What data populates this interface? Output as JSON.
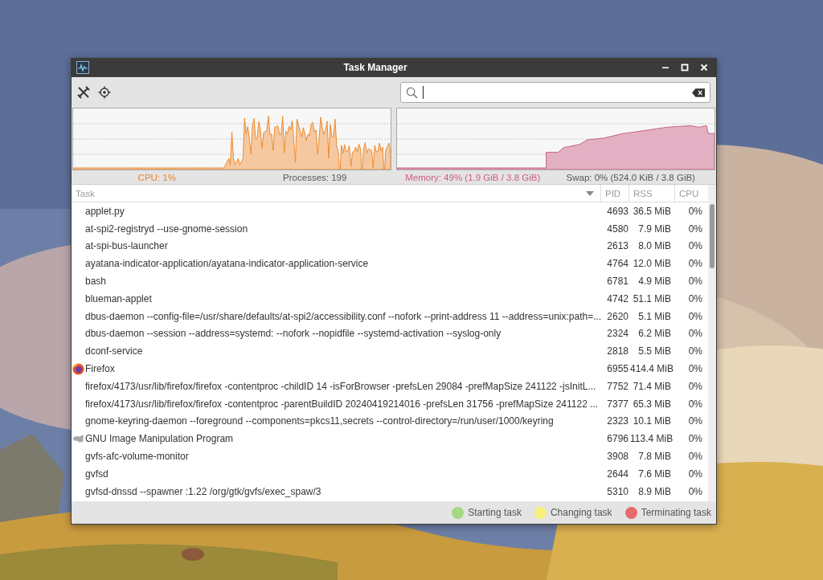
{
  "window": {
    "title": "Task Manager"
  },
  "status": {
    "cpu": "CPU: 1%",
    "processes": "Processes: 199",
    "memory": "Memory: 49% (1.9 GiB / 3.8 GiB)",
    "swap": "Swap: 0% (524.0 KiB / 3.8 GiB)"
  },
  "table": {
    "columns": [
      "Task",
      "PID",
      "RSS",
      "CPU"
    ],
    "rows": [
      {
        "kind": "plain",
        "task": "applet.py",
        "pid": "4693",
        "rss": "36.5 MiB",
        "cpu": "0%"
      },
      {
        "kind": "plain",
        "task": "at-spi2-registryd --use-gnome-session",
        "pid": "4580",
        "rss": "7.9 MiB",
        "cpu": "0%"
      },
      {
        "kind": "plain",
        "task": "at-spi-bus-launcher",
        "pid": "2613",
        "rss": "8.0 MiB",
        "cpu": "0%"
      },
      {
        "kind": "plain",
        "task": "ayatana-indicator-application/ayatana-indicator-application-service",
        "pid": "4764",
        "rss": "12.0 MiB",
        "cpu": "0%"
      },
      {
        "kind": "plain",
        "task": "bash",
        "pid": "6781",
        "rss": "4.9 MiB",
        "cpu": "0%"
      },
      {
        "kind": "plain",
        "task": "blueman-applet",
        "pid": "4742",
        "rss": "51.1 MiB",
        "cpu": "0%"
      },
      {
        "kind": "plain",
        "task": "dbus-daemon --config-file=/usr/share/defaults/at-spi2/accessibility.conf --nofork --print-address 11 --address=unix:path=...",
        "pid": "2620",
        "rss": "5.1 MiB",
        "cpu": "0%"
      },
      {
        "kind": "plain",
        "task": "dbus-daemon --session --address=systemd: --nofork --nopidfile --systemd-activation --syslog-only",
        "pid": "2324",
        "rss": "6.2 MiB",
        "cpu": "0%"
      },
      {
        "kind": "plain",
        "task": "dconf-service",
        "pid": "2818",
        "rss": "5.5 MiB",
        "cpu": "0%"
      },
      {
        "kind": "browser",
        "task": "Firefox",
        "pid": "6955",
        "rss": "414.4 MiB",
        "cpu": "0%"
      },
      {
        "kind": "plain",
        "task": "firefox/4173/usr/lib/firefox/firefox -contentproc -childID 14 -isForBrowser -prefsLen 29084 -prefMapSize 241122 -jsInitL...",
        "pid": "7752",
        "rss": "71.4 MiB",
        "cpu": "0%"
      },
      {
        "kind": "plain",
        "task": "firefox/4173/usr/lib/firefox/firefox -contentproc -parentBuildID 20240419214016 -prefsLen 31756 -prefMapSize 241122 ...",
        "pid": "7377",
        "rss": "65.3 MiB",
        "cpu": "0%"
      },
      {
        "kind": "plain",
        "task": "gnome-keyring-daemon --foreground --components=pkcs11,secrets --control-directory=/run/user/1000/keyring",
        "pid": "2323",
        "rss": "10.1 MiB",
        "cpu": "0%"
      },
      {
        "kind": "graphics",
        "task": "GNU Image Manipulation Program",
        "pid": "6796",
        "rss": "113.4 MiB",
        "cpu": "0%"
      },
      {
        "kind": "plain",
        "task": "gvfs-afc-volume-monitor",
        "pid": "3908",
        "rss": "7.8 MiB",
        "cpu": "0%"
      },
      {
        "kind": "plain",
        "task": "gvfsd",
        "pid": "2644",
        "rss": "7.6 MiB",
        "cpu": "0%"
      },
      {
        "kind": "plain",
        "task": "gvfsd-dnssd --spawner :1.22 /org/gtk/gvfs/exec_spaw/3",
        "pid": "5310",
        "rss": "8.9 MiB",
        "cpu": "0%"
      }
    ]
  },
  "legend": [
    {
      "label": "Starting task",
      "color": "#a6d785"
    },
    {
      "label": "Changing task",
      "color": "#f8f07a"
    },
    {
      "label": "Terminating task",
      "color": "#e86a6a"
    }
  ]
}
